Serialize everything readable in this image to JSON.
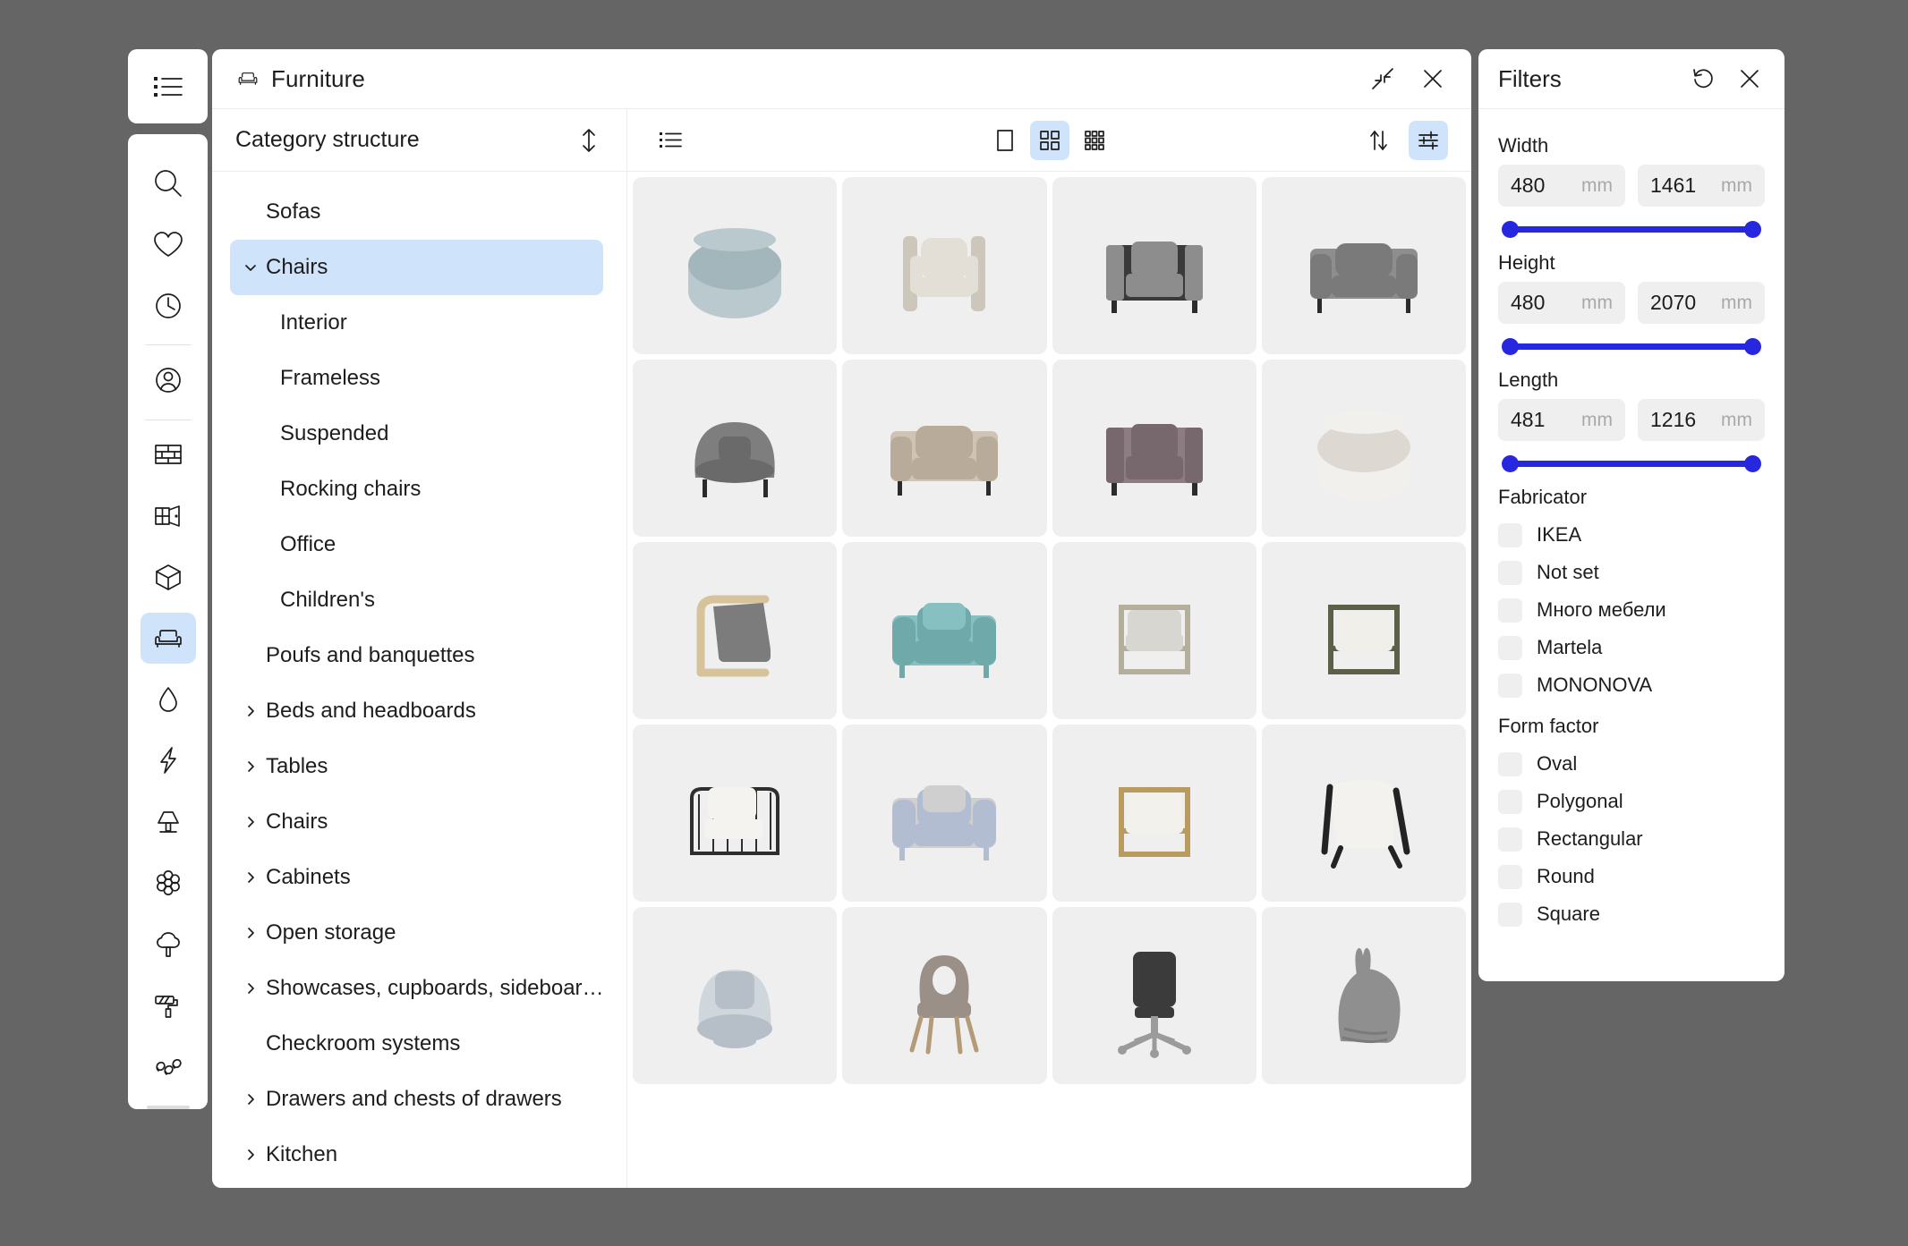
{
  "colors": {
    "desktop_background": "#656565",
    "accent_selection": "#cfe3fa",
    "slider_blue": "#2727e0",
    "cell_background": "#efefef",
    "panel_white": "#ffffff"
  },
  "left_rail": {
    "top_button": {
      "icon": "list-menu-icon",
      "name": "main-menu"
    },
    "items": [
      {
        "icon": "search-icon",
        "name": "search",
        "active": false
      },
      {
        "icon": "heart-icon",
        "name": "favorites",
        "active": false
      },
      {
        "icon": "clock-icon",
        "name": "recent",
        "active": false
      },
      {
        "separator_after": true,
        "icon": "user-circle-icon",
        "name": "account",
        "active": false
      },
      {
        "separator_after": true,
        "icon": "wall-brick-icon",
        "name": "walls",
        "active": false
      },
      {
        "icon": "window-door-icon",
        "name": "windows-doors",
        "active": false
      },
      {
        "icon": "cube-icon",
        "name": "objects-3d",
        "active": false
      },
      {
        "icon": "armchair-icon",
        "name": "furniture",
        "active": true
      },
      {
        "icon": "water-drop-icon",
        "name": "plumbing",
        "active": false
      },
      {
        "icon": "lightning-bolt-icon",
        "name": "electrics",
        "active": false
      },
      {
        "icon": "lamp-icon",
        "name": "lighting",
        "active": false
      },
      {
        "icon": "flower-icon",
        "name": "decor",
        "active": false
      },
      {
        "icon": "tree-icon",
        "name": "plants",
        "active": false
      },
      {
        "icon": "paint-roller-icon",
        "name": "materials",
        "active": false
      },
      {
        "icon": "squiggle-icon",
        "name": "misc",
        "active": false
      }
    ]
  },
  "window": {
    "title": "Furniture",
    "title_icon": "armchair-icon",
    "collapse_button": {
      "icon": "collapse-arrows-icon",
      "label": "Collapse"
    },
    "close_button": {
      "icon": "close-icon",
      "label": "Close"
    }
  },
  "category_panel": {
    "header": "Category structure",
    "sort_icon": "sort-vertical-icon",
    "items": [
      {
        "label": "Sofas",
        "level": 0,
        "caret": "none",
        "selected": false
      },
      {
        "label": "Chairs",
        "level": 0,
        "caret": "down",
        "selected": true
      },
      {
        "label": "Interior",
        "level": 1,
        "caret": "none",
        "selected": false
      },
      {
        "label": "Frameless",
        "level": 1,
        "caret": "none",
        "selected": false
      },
      {
        "label": "Suspended",
        "level": 1,
        "caret": "none",
        "selected": false
      },
      {
        "label": "Rocking chairs",
        "level": 1,
        "caret": "none",
        "selected": false
      },
      {
        "label": "Office",
        "level": 1,
        "caret": "none",
        "selected": false
      },
      {
        "label": "Children's",
        "level": 1,
        "caret": "none",
        "selected": false
      },
      {
        "label": "Poufs and banquettes",
        "level": 0,
        "caret": "none",
        "selected": false
      },
      {
        "label": "Beds and headboards",
        "level": 0,
        "caret": "right",
        "selected": false
      },
      {
        "label": "Tables",
        "level": 0,
        "caret": "right",
        "selected": false
      },
      {
        "label": "Chairs",
        "level": 0,
        "caret": "right",
        "selected": false
      },
      {
        "label": "Cabinets",
        "level": 0,
        "caret": "right",
        "selected": false
      },
      {
        "label": "Open storage",
        "level": 0,
        "caret": "right",
        "selected": false
      },
      {
        "label": "Showcases, cupboards, sideboar…",
        "level": 0,
        "caret": "right",
        "selected": false
      },
      {
        "label": "Checkroom systems",
        "level": 0,
        "caret": "none",
        "selected": false
      },
      {
        "label": "Drawers and chests of drawers",
        "level": 0,
        "caret": "right",
        "selected": false
      },
      {
        "label": "Kitchen",
        "level": 0,
        "caret": "right",
        "selected": false
      }
    ]
  },
  "content_toolbar": {
    "list_view_button": {
      "icon": "list-view-icon",
      "active": false
    },
    "size_buttons": [
      {
        "icon": "single-tile-icon",
        "name": "large-tiles",
        "active": false
      },
      {
        "icon": "grid-2x2-icon",
        "name": "medium-tiles",
        "active": true
      },
      {
        "icon": "grid-3x3-icon",
        "name": "small-tiles",
        "active": false
      }
    ],
    "sort_button": {
      "icon": "sort-arrows-icon",
      "active": false
    },
    "filter_button": {
      "icon": "filter-sliders-icon",
      "active": true
    }
  },
  "product_grid": {
    "columns": 4,
    "items": [
      {
        "name": "round-swivel-chair-teal",
        "type": "round-pouf-back",
        "color": "#b9c9cd",
        "shade": "#a3b6bb"
      },
      {
        "name": "cream-framed-armchair",
        "type": "frame-armchair",
        "color": "#e3ded6",
        "shade": "#cdc6bb"
      },
      {
        "name": "black-grey-boxy-armchair",
        "type": "boxy-armchair",
        "color": "#3a3a3a",
        "shade": "#8d8d8d"
      },
      {
        "name": "grey-wide-armchair",
        "type": "wide-armchair",
        "color": "#8e8e8e",
        "shade": "#7a7a7a"
      },
      {
        "name": "dark-grey-barrel-chair",
        "type": "barrel-chair",
        "color": "#7e7e7e",
        "shade": "#6a6a6a"
      },
      {
        "name": "beige-armchair",
        "type": "wide-armchair",
        "color": "#cfc3b3",
        "shade": "#b8ab99"
      },
      {
        "name": "mauve-lounge-chair",
        "type": "boxy-armchair",
        "color": "#8d7d83",
        "shade": "#77686e"
      },
      {
        "name": "white-swivel-chair",
        "type": "round-pouf-back",
        "color": "#f2f0ec",
        "shade": "#ddd9d2"
      },
      {
        "name": "wood-frame-lounge-chair-grey",
        "type": "poang-chair",
        "color": "#7c7c7c",
        "shade": "#d6c29b"
      },
      {
        "name": "teal-tufted-armchair",
        "type": "tufted-armchair",
        "color": "#87c0c0",
        "shade": "#6fa9a9"
      },
      {
        "name": "metal-frame-armchair-grey",
        "type": "metal-frame-chair",
        "color": "#d8d6d1",
        "shade": "#b4ae9d"
      },
      {
        "name": "olive-frame-tufted-chair",
        "type": "metal-frame-chair",
        "color": "#f0efe9",
        "shade": "#5b6148"
      },
      {
        "name": "black-rattan-armchair",
        "type": "rattan-chair",
        "color": "#f4f3f0",
        "shade": "#2e2e2e"
      },
      {
        "name": "grey-tufted-armchair-throw",
        "type": "tufted-armchair",
        "color": "#cfcfcf",
        "shade": "#b3bdd2"
      },
      {
        "name": "gold-frame-white-armchair",
        "type": "metal-frame-chair",
        "color": "#f2f1ec",
        "shade": "#b99a5f"
      },
      {
        "name": "white-accent-chair-black-legs",
        "type": "accent-chair",
        "color": "#f3f2ef",
        "shade": "#232323"
      },
      {
        "name": "light-blue-swivel-armchair",
        "type": "swivel-armchair",
        "color": "#cfd6dc",
        "shade": "#b6bfc7"
      },
      {
        "name": "taupe-dining-chair",
        "type": "dining-chair",
        "color": "#9a9087",
        "shade": "#b39b78"
      },
      {
        "name": "black-office-chair",
        "type": "office-chair",
        "color": "#3b3b3b",
        "shade": "#9b9b9b"
      },
      {
        "name": "grey-bunny-bean-bag",
        "type": "bean-bag",
        "color": "#8f8f8f",
        "shade": "#7a7a7a"
      }
    ]
  },
  "filters_panel": {
    "title": "Filters",
    "reset_button": {
      "icon": "reset-icon",
      "label": "Reset"
    },
    "close_button": {
      "icon": "close-icon",
      "label": "Close"
    },
    "ranges": [
      {
        "label": "Width",
        "min_value": "480",
        "max_value": "1461",
        "unit": "mm",
        "fill_start_pct": 0,
        "fill_end_pct": 100
      },
      {
        "label": "Height",
        "min_value": "480",
        "max_value": "2070",
        "unit": "mm",
        "fill_start_pct": 0,
        "fill_end_pct": 100
      },
      {
        "label": "Length",
        "min_value": "481",
        "max_value": "1216",
        "unit": "mm",
        "fill_start_pct": 0,
        "fill_end_pct": 100
      }
    ],
    "checkbox_groups": [
      {
        "label": "Fabricator",
        "options": [
          {
            "label": "IKEA",
            "checked": false
          },
          {
            "label": "Not set",
            "checked": false
          },
          {
            "label": "Много мебели",
            "checked": false
          },
          {
            "label": "Martela",
            "checked": false
          },
          {
            "label": "MONONOVA",
            "checked": false
          }
        ]
      },
      {
        "label": "Form factor",
        "options": [
          {
            "label": "Oval",
            "checked": false
          },
          {
            "label": "Polygonal",
            "checked": false
          },
          {
            "label": "Rectangular",
            "checked": false
          },
          {
            "label": "Round",
            "checked": false
          },
          {
            "label": "Square",
            "checked": false
          }
        ]
      }
    ]
  }
}
